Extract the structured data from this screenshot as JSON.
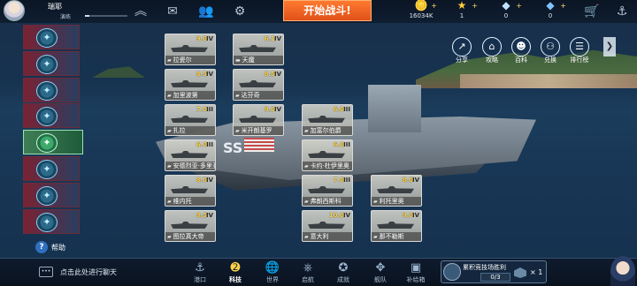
{
  "player": {
    "name": "瑞耶",
    "level_text": "演练",
    "xp_fraction": 0.1
  },
  "topbar": {
    "battle_label": "开始战斗!",
    "resources": [
      {
        "icon": "gold-coin-icon",
        "value": "16034K"
      },
      {
        "icon": "star-icon",
        "value": "1"
      },
      {
        "icon": "diamond-icon",
        "value": "0"
      },
      {
        "icon": "gem-icon",
        "value": "0"
      }
    ]
  },
  "help_label": "帮助",
  "ship_cards": [
    {
      "name": "拉瓷尔",
      "rating": "9.0",
      "tier": "IV"
    },
    {
      "name": "天魔",
      "rating": "6.1",
      "tier": "IV"
    },
    {
      "name": "加里波第",
      "rating": "8.5",
      "tier": "IV"
    },
    {
      "name": "达芬奇",
      "rating": "8.5",
      "tier": "IV"
    },
    {
      "name": "扎拉",
      "rating": "7.0",
      "tier": "III"
    },
    {
      "name": "米开朗基罗",
      "rating": "9.0",
      "tier": "IV"
    },
    {
      "name": "加富尔伯爵",
      "rating": "6.0",
      "tier": "III"
    },
    {
      "name": "安德烈亚·多里亚",
      "rating": "6.0",
      "tier": "III"
    },
    {
      "name": "卡约·杜伊里奥",
      "rating": "6.0",
      "tier": "III"
    },
    {
      "name": "维内托",
      "rating": "8.0",
      "tier": "IV"
    },
    {
      "name": "弗朗西斯科",
      "rating": "7.0",
      "tier": "III"
    },
    {
      "name": "利托里奥",
      "rating": "8.0",
      "tier": "IV"
    },
    {
      "name": "图拉真大帝",
      "rating": "8.5",
      "tier": "IV"
    },
    {
      "name": "意大利",
      "rating": "10.0",
      "tier": "IV"
    },
    {
      "name": "那不勒斯",
      "rating": "9.0",
      "tier": "IV"
    }
  ],
  "right_icons": [
    {
      "label": "分享",
      "icon": "share-icon"
    },
    {
      "label": "攻略",
      "icon": "guide-icon"
    },
    {
      "label": "百科",
      "icon": "wiki-icon"
    },
    {
      "label": "兑换",
      "icon": "redeem-icon"
    },
    {
      "label": "排行榜",
      "icon": "leaderboard-icon"
    }
  ],
  "bottom": {
    "chat_text": "点击此处进行聊天",
    "nav": [
      {
        "label": "港口",
        "icon": "port-icon"
      },
      {
        "label": "科技",
        "icon": "tech-icon"
      },
      {
        "label": "世界",
        "icon": "world-icon"
      },
      {
        "label": "启航",
        "icon": "sail-icon"
      },
      {
        "label": "成就",
        "icon": "achievement-icon"
      },
      {
        "label": "舰队",
        "icon": "fleet-icon"
      },
      {
        "label": "补给箱",
        "icon": "supply-box-icon"
      }
    ],
    "quest": {
      "title": "累积竞技场胜利",
      "progress": "0/3",
      "reward_count": "× 1"
    }
  }
}
